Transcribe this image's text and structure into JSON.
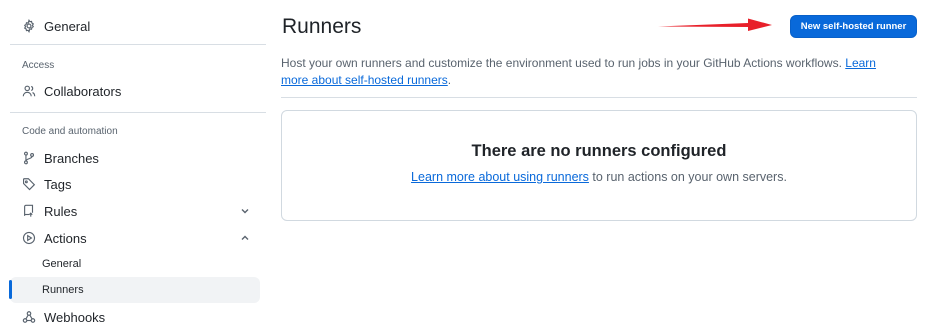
{
  "sidebar": {
    "general": "General",
    "access_heading": "Access",
    "collaborators": "Collaborators",
    "code_automation_heading": "Code and automation",
    "branches": "Branches",
    "tags": "Tags",
    "rules": "Rules",
    "actions": "Actions",
    "actions_sub": {
      "general": "General",
      "runners": "Runners"
    },
    "webhooks": "Webhooks"
  },
  "main": {
    "title": "Runners",
    "new_runner_button": "New self-hosted runner",
    "description_text": "Host your own runners and customize the environment used to run jobs in your GitHub Actions workflows. ",
    "description_link": "Learn more about self-hosted runners",
    "description_end": ".",
    "empty_state": {
      "title": "There are no runners configured",
      "link": "Learn more about using runners",
      "text": " to run actions on your own servers."
    }
  },
  "colors": {
    "accent": "#0969da",
    "annotation_arrow": "#e8202a"
  },
  "icons": {
    "general": "gear-icon",
    "collaborators": "people-icon",
    "branches": "git-branch-icon",
    "tags": "tag-icon",
    "rules": "repo-push-icon",
    "actions": "play-circle-icon",
    "webhooks": "webhook-icon"
  }
}
